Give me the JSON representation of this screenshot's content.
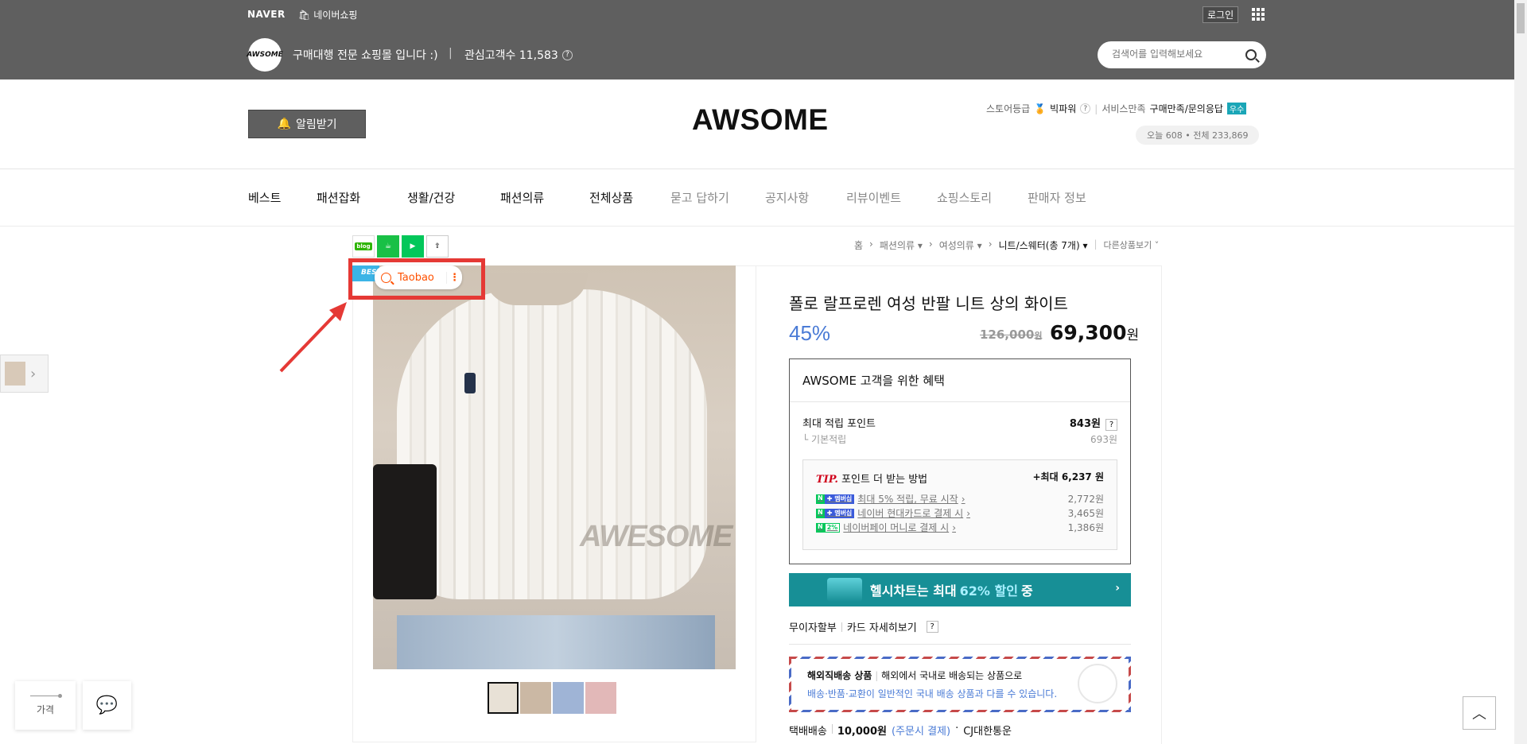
{
  "topbar": {
    "brand": "NAVER",
    "shopping": "네이버쇼핑",
    "login": "로그인"
  },
  "store": {
    "logo_text": "AWSOME",
    "description": "구매대행 전문 쇼핑몰 입니다 :)",
    "separator": "|",
    "fans_label": "관심고객수 11,583",
    "search_placeholder": "검색어를 입력해보세요"
  },
  "header": {
    "notify_label": "알림받기",
    "title": "AWSOME",
    "grade_label": "스토어등급",
    "grade_value": "빅파워",
    "service_label": "서비스만족",
    "service_value": "구매만족/문의응답",
    "service_badge": "우수",
    "visitors": "오늘 608 • 전체 233,869"
  },
  "nav": {
    "items": [
      {
        "label": "베스트",
        "dropdown": false,
        "muted": false
      },
      {
        "label": "패션잡화",
        "dropdown": true,
        "muted": false
      },
      {
        "label": "생활/건강",
        "dropdown": true,
        "muted": false
      },
      {
        "label": "패션의류",
        "dropdown": true,
        "muted": false
      },
      {
        "label": "전체상품",
        "dropdown": false,
        "muted": false
      },
      {
        "label": "묻고 답하기",
        "dropdown": false,
        "muted": true
      },
      {
        "label": "공지사항",
        "dropdown": false,
        "muted": true
      },
      {
        "label": "리뷰이벤트",
        "dropdown": false,
        "muted": true
      },
      {
        "label": "쇼핑스토리",
        "dropdown": false,
        "muted": true
      },
      {
        "label": "판매자 정보",
        "dropdown": false,
        "muted": true
      }
    ]
  },
  "social": {
    "blog": "blog"
  },
  "breadcrumb": {
    "items": [
      "홈",
      "패션의류",
      "여성의류",
      "니트/스웨터(총 7개)"
    ],
    "more": "다른상품보기"
  },
  "image": {
    "best_tag": "BEST",
    "watermark": "AWESOME",
    "taobao_label": "Taobao"
  },
  "side": {
    "price_label": "가격"
  },
  "product": {
    "title": "폴로 랄프로렌 여성 반팔 니트 상의 화이트",
    "discount": "45%",
    "original_price": "126,000",
    "original_unit": "원",
    "price": "69,300",
    "price_unit": "원"
  },
  "benefit": {
    "title": "AWSOME 고객을 위한 혜택",
    "max_point_label": "최대 적립 포인트",
    "max_point_value": "843원",
    "base_label": "기본적립",
    "base_value": "693원",
    "tip_prefix": "TIP.",
    "tip_title": "포인트 더 받는 방법",
    "tip_max": "+최대 6,237 원",
    "rows": [
      {
        "badge": "멤버십",
        "label": "최대 5% 적립, 무료 시작",
        "value": "2,772원"
      },
      {
        "badge": "멤버십",
        "label": "네이버 현대카드로 결제 시",
        "value": "3,465원"
      },
      {
        "badge": "2%",
        "label": "네이버페이 머니로 결제 시",
        "value": "1,386원"
      }
    ]
  },
  "banner": {
    "prefix": "헬시차트는 최대",
    "highlight": "62% 할인",
    "suffix": "중"
  },
  "installment": {
    "label": "무이자할부",
    "card_detail": "카드 자세히보기"
  },
  "overseas": {
    "title": "해외직배송 상품",
    "desc": "해외에서 국내로 배송되는 상품으로",
    "notice": "배송·반품·교환이 일반적인 국내 배송 상품과 다를 수 있습니다."
  },
  "shipping": {
    "method": "택배배송",
    "fee": "10,000원",
    "condition": "(주문시 결제)",
    "carrier": "CJ대한통운"
  }
}
